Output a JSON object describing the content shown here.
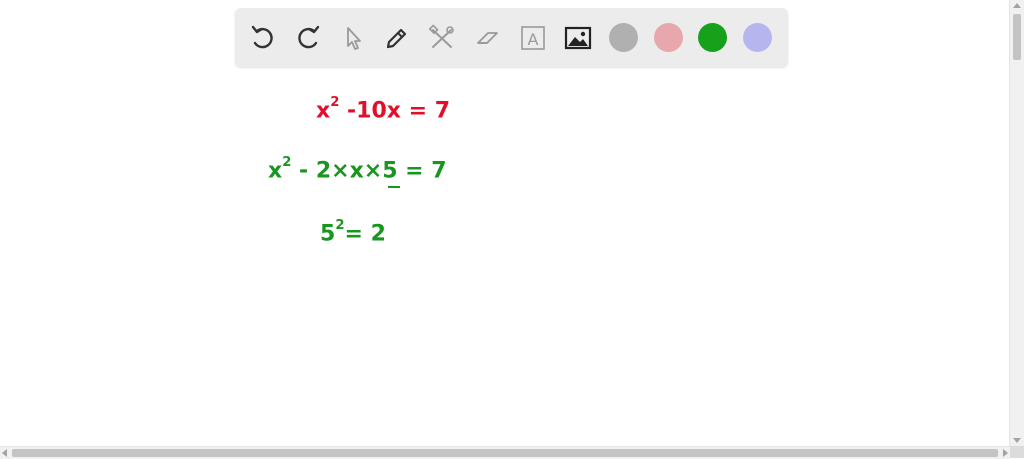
{
  "toolbar": {
    "tools": [
      {
        "name": "undo-icon"
      },
      {
        "name": "redo-icon"
      },
      {
        "name": "select-pointer-icon"
      },
      {
        "name": "pen-icon"
      },
      {
        "name": "tools-icon"
      },
      {
        "name": "eraser-icon"
      },
      {
        "name": "text-box-icon",
        "label": "A"
      },
      {
        "name": "image-icon"
      }
    ],
    "colors": [
      "#b0b0b0",
      "#e8a6ad",
      "#15a11a",
      "#b7b5ee"
    ]
  },
  "canvas": {
    "ink_colors": {
      "red": "#e0102a",
      "green": "#19961f"
    },
    "lines": [
      {
        "base": "x",
        "sup": "2",
        "rest": " -10x  = 7"
      },
      {
        "base": "x",
        "sup": "2",
        "rest": " - 2×x×5  =  7"
      },
      {
        "base": "5",
        "sup": "2",
        "rest": "= 2"
      }
    ]
  }
}
